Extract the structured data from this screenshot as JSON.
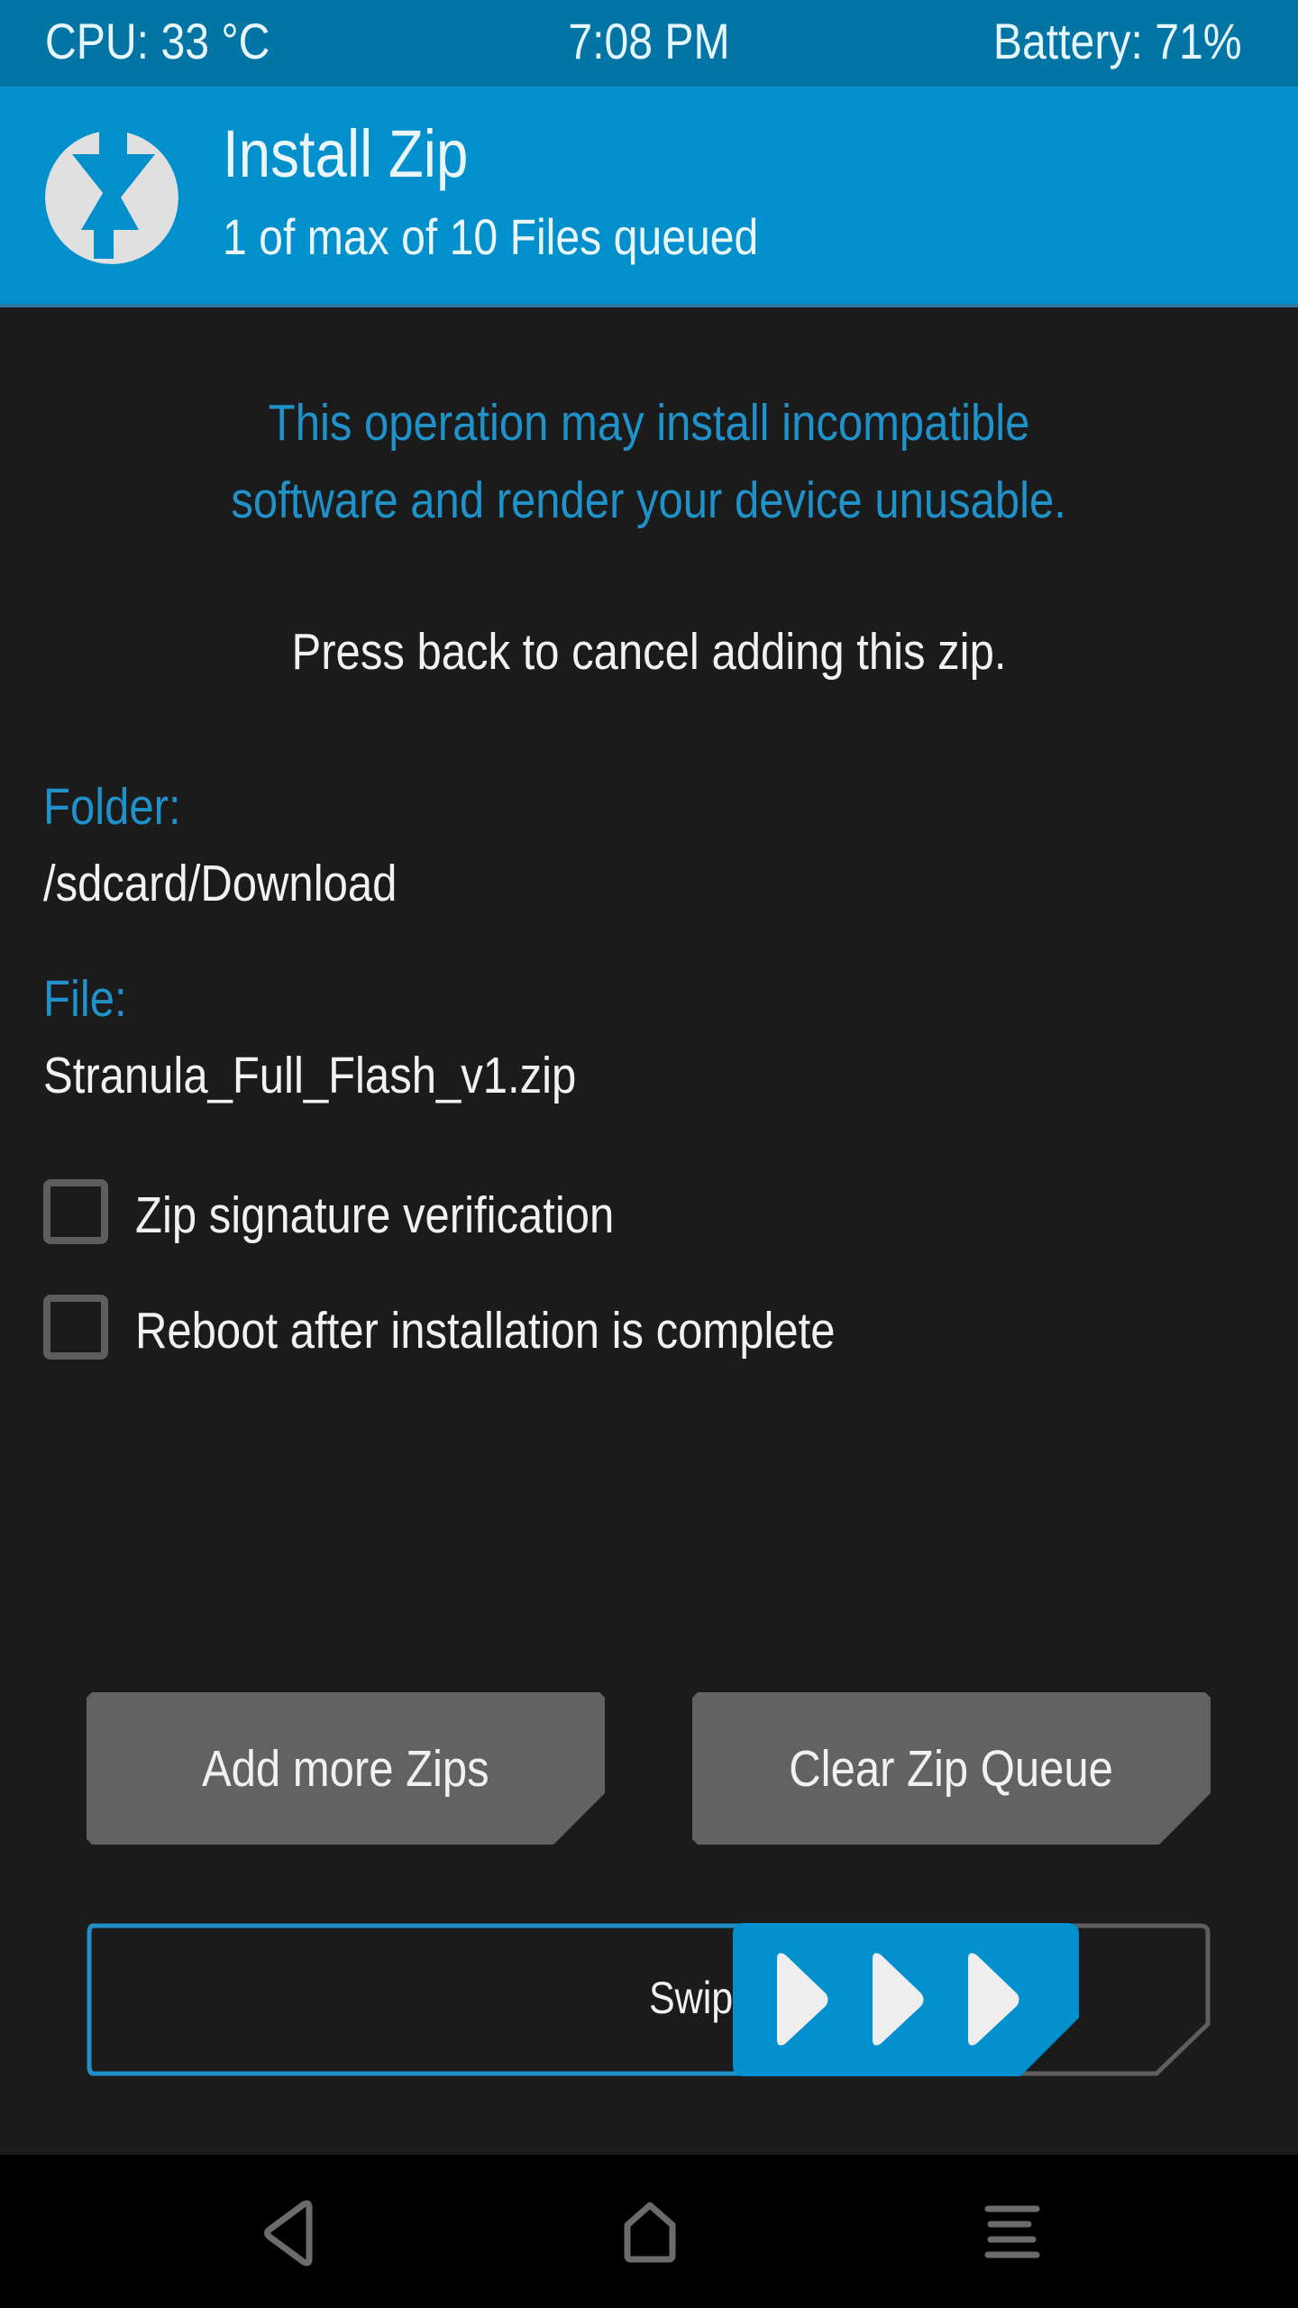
{
  "status_bar": {
    "cpu": "CPU: 33 °C",
    "time": "7:08 PM",
    "battery": "Battery: 71%"
  },
  "header": {
    "logo_icon": "twrp-logo-icon",
    "title": "Install Zip",
    "subtitle": "1 of max of 10 Files queued"
  },
  "warning": {
    "line1": "This operation may install incompatible",
    "line2": "software and render your device unusable."
  },
  "instruction": "Press back to cancel adding this zip.",
  "folder": {
    "label": "Folder:",
    "value": "/sdcard/Download"
  },
  "file": {
    "label": "File:",
    "value": "Stranula_Full_Flash_v1.zip"
  },
  "options": [
    {
      "label": "Zip signature verification",
      "checked": false
    },
    {
      "label": "Reboot after installation is complete",
      "checked": false
    }
  ],
  "buttons": {
    "add_more": "Add more Zips",
    "clear_queue": "Clear Zip Queue"
  },
  "slider": {
    "label": "Swipe to confirm Flash",
    "progress": 0.57
  },
  "nav": {
    "back_icon": "back-icon",
    "home_icon": "home-icon",
    "menu_icon": "menu-icon"
  },
  "colors": {
    "status_bar": "#0275a5",
    "header": "#0290cc",
    "accent_text": "#1f92ca",
    "background": "#1b1b1b",
    "button": "#626262"
  }
}
